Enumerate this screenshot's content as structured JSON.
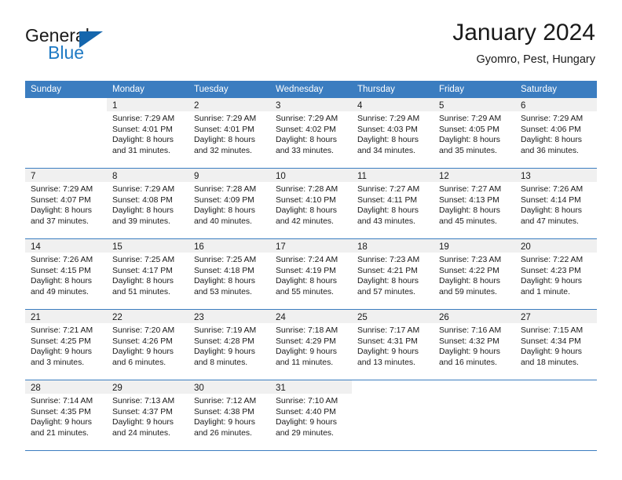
{
  "brand": {
    "name_part1": "General",
    "name_part2": "Blue",
    "triangle_color": "#1566ad",
    "blue_color": "#1f7ac4"
  },
  "header": {
    "title": "January 2024",
    "subtitle": "Gyomro, Pest, Hungary"
  },
  "theme": {
    "header_blue": "#3b7dc0",
    "day_band_gray": "#f0f0f0"
  },
  "weekdays": [
    "Sunday",
    "Monday",
    "Tuesday",
    "Wednesday",
    "Thursday",
    "Friday",
    "Saturday"
  ],
  "weeks": [
    [
      {
        "day": "",
        "blank": true,
        "lines": []
      },
      {
        "day": "1",
        "lines": [
          "Sunrise: 7:29 AM",
          "Sunset: 4:01 PM",
          "Daylight: 8 hours",
          "and 31 minutes."
        ]
      },
      {
        "day": "2",
        "lines": [
          "Sunrise: 7:29 AM",
          "Sunset: 4:01 PM",
          "Daylight: 8 hours",
          "and 32 minutes."
        ]
      },
      {
        "day": "3",
        "lines": [
          "Sunrise: 7:29 AM",
          "Sunset: 4:02 PM",
          "Daylight: 8 hours",
          "and 33 minutes."
        ]
      },
      {
        "day": "4",
        "lines": [
          "Sunrise: 7:29 AM",
          "Sunset: 4:03 PM",
          "Daylight: 8 hours",
          "and 34 minutes."
        ]
      },
      {
        "day": "5",
        "lines": [
          "Sunrise: 7:29 AM",
          "Sunset: 4:05 PM",
          "Daylight: 8 hours",
          "and 35 minutes."
        ]
      },
      {
        "day": "6",
        "lines": [
          "Sunrise: 7:29 AM",
          "Sunset: 4:06 PM",
          "Daylight: 8 hours",
          "and 36 minutes."
        ]
      }
    ],
    [
      {
        "day": "7",
        "lines": [
          "Sunrise: 7:29 AM",
          "Sunset: 4:07 PM",
          "Daylight: 8 hours",
          "and 37 minutes."
        ]
      },
      {
        "day": "8",
        "lines": [
          "Sunrise: 7:29 AM",
          "Sunset: 4:08 PM",
          "Daylight: 8 hours",
          "and 39 minutes."
        ]
      },
      {
        "day": "9",
        "lines": [
          "Sunrise: 7:28 AM",
          "Sunset: 4:09 PM",
          "Daylight: 8 hours",
          "and 40 minutes."
        ]
      },
      {
        "day": "10",
        "lines": [
          "Sunrise: 7:28 AM",
          "Sunset: 4:10 PM",
          "Daylight: 8 hours",
          "and 42 minutes."
        ]
      },
      {
        "day": "11",
        "lines": [
          "Sunrise: 7:27 AM",
          "Sunset: 4:11 PM",
          "Daylight: 8 hours",
          "and 43 minutes."
        ]
      },
      {
        "day": "12",
        "lines": [
          "Sunrise: 7:27 AM",
          "Sunset: 4:13 PM",
          "Daylight: 8 hours",
          "and 45 minutes."
        ]
      },
      {
        "day": "13",
        "lines": [
          "Sunrise: 7:26 AM",
          "Sunset: 4:14 PM",
          "Daylight: 8 hours",
          "and 47 minutes."
        ]
      }
    ],
    [
      {
        "day": "14",
        "lines": [
          "Sunrise: 7:26 AM",
          "Sunset: 4:15 PM",
          "Daylight: 8 hours",
          "and 49 minutes."
        ]
      },
      {
        "day": "15",
        "lines": [
          "Sunrise: 7:25 AM",
          "Sunset: 4:17 PM",
          "Daylight: 8 hours",
          "and 51 minutes."
        ]
      },
      {
        "day": "16",
        "lines": [
          "Sunrise: 7:25 AM",
          "Sunset: 4:18 PM",
          "Daylight: 8 hours",
          "and 53 minutes."
        ]
      },
      {
        "day": "17",
        "lines": [
          "Sunrise: 7:24 AM",
          "Sunset: 4:19 PM",
          "Daylight: 8 hours",
          "and 55 minutes."
        ]
      },
      {
        "day": "18",
        "lines": [
          "Sunrise: 7:23 AM",
          "Sunset: 4:21 PM",
          "Daylight: 8 hours",
          "and 57 minutes."
        ]
      },
      {
        "day": "19",
        "lines": [
          "Sunrise: 7:23 AM",
          "Sunset: 4:22 PM",
          "Daylight: 8 hours",
          "and 59 minutes."
        ]
      },
      {
        "day": "20",
        "lines": [
          "Sunrise: 7:22 AM",
          "Sunset: 4:23 PM",
          "Daylight: 9 hours",
          "and 1 minute."
        ]
      }
    ],
    [
      {
        "day": "21",
        "lines": [
          "Sunrise: 7:21 AM",
          "Sunset: 4:25 PM",
          "Daylight: 9 hours",
          "and 3 minutes."
        ]
      },
      {
        "day": "22",
        "lines": [
          "Sunrise: 7:20 AM",
          "Sunset: 4:26 PM",
          "Daylight: 9 hours",
          "and 6 minutes."
        ]
      },
      {
        "day": "23",
        "lines": [
          "Sunrise: 7:19 AM",
          "Sunset: 4:28 PM",
          "Daylight: 9 hours",
          "and 8 minutes."
        ]
      },
      {
        "day": "24",
        "lines": [
          "Sunrise: 7:18 AM",
          "Sunset: 4:29 PM",
          "Daylight: 9 hours",
          "and 11 minutes."
        ]
      },
      {
        "day": "25",
        "lines": [
          "Sunrise: 7:17 AM",
          "Sunset: 4:31 PM",
          "Daylight: 9 hours",
          "and 13 minutes."
        ]
      },
      {
        "day": "26",
        "lines": [
          "Sunrise: 7:16 AM",
          "Sunset: 4:32 PM",
          "Daylight: 9 hours",
          "and 16 minutes."
        ]
      },
      {
        "day": "27",
        "lines": [
          "Sunrise: 7:15 AM",
          "Sunset: 4:34 PM",
          "Daylight: 9 hours",
          "and 18 minutes."
        ]
      }
    ],
    [
      {
        "day": "28",
        "lines": [
          "Sunrise: 7:14 AM",
          "Sunset: 4:35 PM",
          "Daylight: 9 hours",
          "and 21 minutes."
        ]
      },
      {
        "day": "29",
        "lines": [
          "Sunrise: 7:13 AM",
          "Sunset: 4:37 PM",
          "Daylight: 9 hours",
          "and 24 minutes."
        ]
      },
      {
        "day": "30",
        "lines": [
          "Sunrise: 7:12 AM",
          "Sunset: 4:38 PM",
          "Daylight: 9 hours",
          "and 26 minutes."
        ]
      },
      {
        "day": "31",
        "lines": [
          "Sunrise: 7:10 AM",
          "Sunset: 4:40 PM",
          "Daylight: 9 hours",
          "and 29 minutes."
        ]
      },
      {
        "day": "",
        "blank": true,
        "lines": []
      },
      {
        "day": "",
        "blank": true,
        "lines": []
      },
      {
        "day": "",
        "blank": true,
        "lines": []
      }
    ]
  ]
}
